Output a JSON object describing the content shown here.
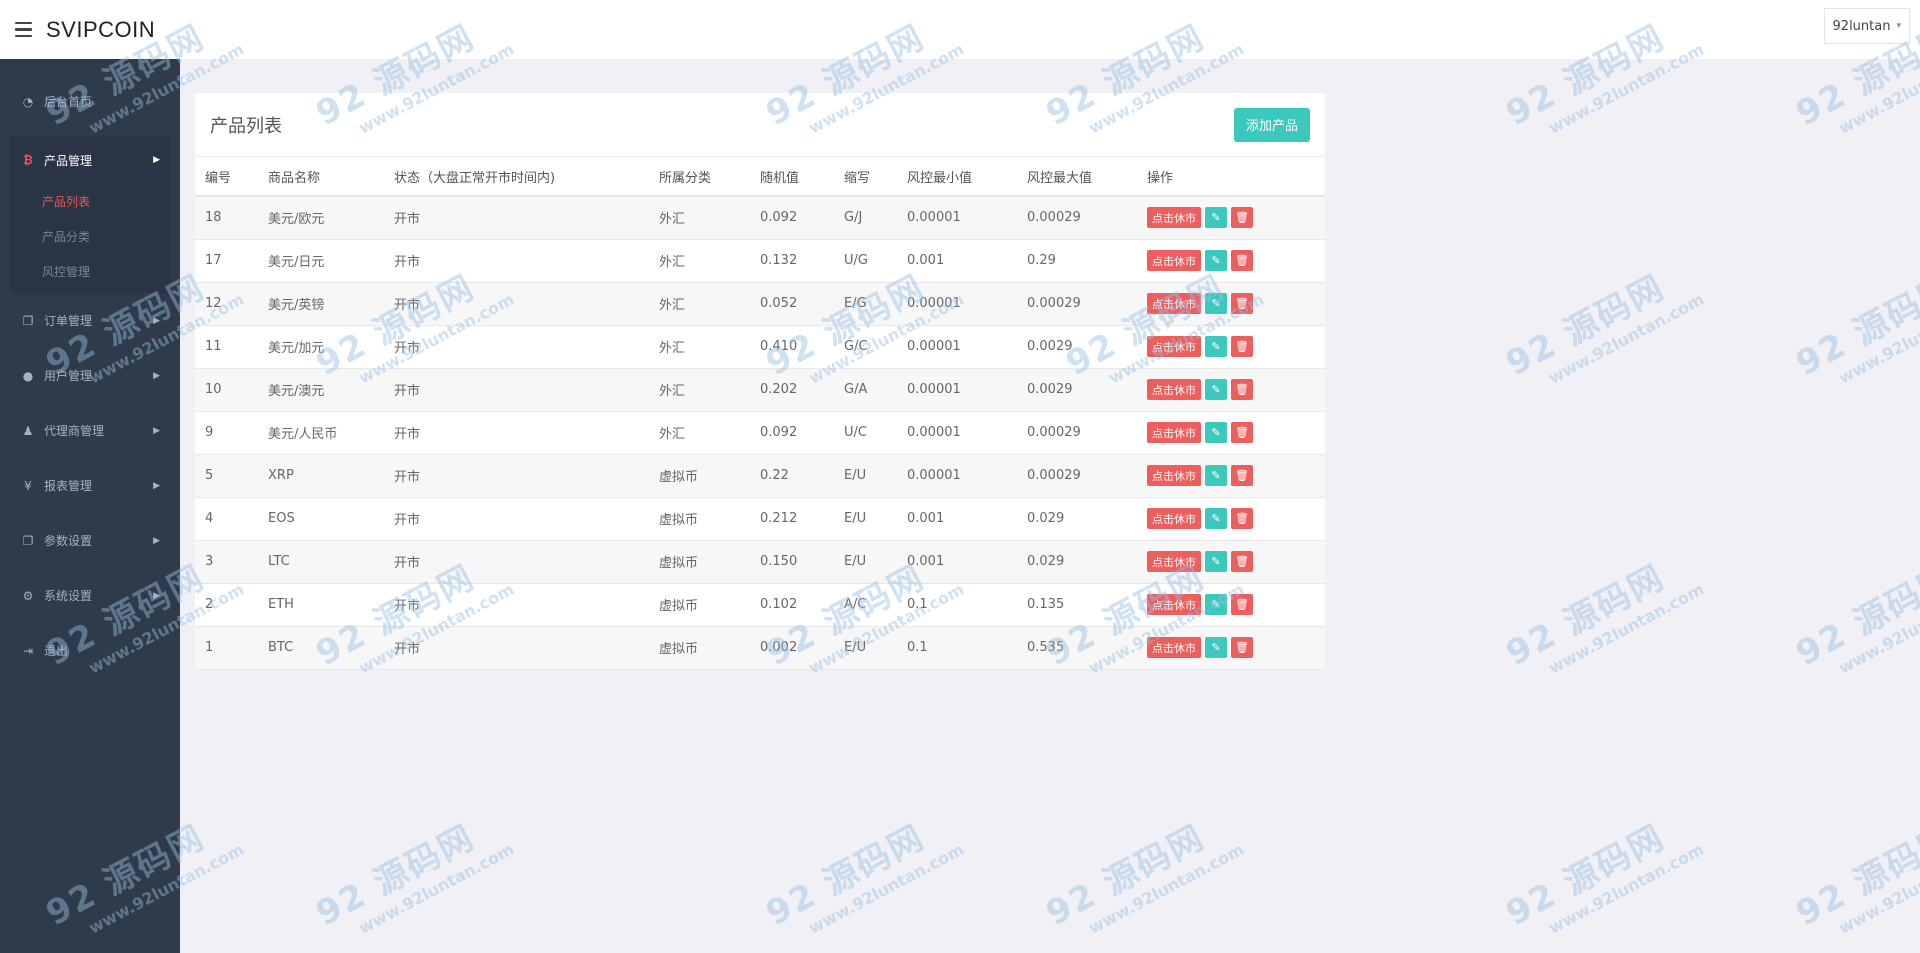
{
  "header": {
    "brand": "SVIPCOIN",
    "user": "92luntan"
  },
  "sidebar": {
    "items": [
      {
        "label": "后台首页",
        "icon": "dashboard-icon"
      },
      {
        "label": "产品管理",
        "icon": "bitcoin-icon"
      },
      {
        "label": "订单管理",
        "icon": "copy-icon"
      },
      {
        "label": "用户管理",
        "icon": "user-icon"
      },
      {
        "label": "代理商管理",
        "icon": "users-icon"
      },
      {
        "label": "报表管理",
        "icon": "yen-icon"
      },
      {
        "label": "参数设置",
        "icon": "copy-icon"
      },
      {
        "label": "系统设置",
        "icon": "gears-icon"
      },
      {
        "label": "退出",
        "icon": "sign-out-icon"
      }
    ],
    "sub_items": [
      {
        "label": "产品列表",
        "active": true
      },
      {
        "label": "产品分类",
        "active": false
      },
      {
        "label": "风控管理",
        "active": false
      }
    ]
  },
  "panel": {
    "title": "产品列表",
    "add_button": "添加产品"
  },
  "table": {
    "columns": [
      "编号",
      "商品名称",
      "状态（大盘正常开市时间内)",
      "所属分类",
      "随机值",
      "缩写",
      "风控最小值",
      "风控最大值",
      "操作"
    ],
    "action_label": "点击休市",
    "rows": [
      {
        "id": "18",
        "name": "美元/欧元",
        "status": "开市",
        "category": "外汇",
        "random": "0.092",
        "abbr": "G/J",
        "min": "0.00001",
        "max": "0.00029"
      },
      {
        "id": "17",
        "name": "美元/日元",
        "status": "开市",
        "category": "外汇",
        "random": "0.132",
        "abbr": "U/G",
        "min": "0.001",
        "max": "0.29"
      },
      {
        "id": "12",
        "name": "美元/英镑",
        "status": "开市",
        "category": "外汇",
        "random": "0.052",
        "abbr": "E/G",
        "min": "0.00001",
        "max": "0.00029"
      },
      {
        "id": "11",
        "name": "美元/加元",
        "status": "开市",
        "category": "外汇",
        "random": "0.410",
        "abbr": "G/C",
        "min": "0.00001",
        "max": "0.0029"
      },
      {
        "id": "10",
        "name": "美元/澳元",
        "status": "开市",
        "category": "外汇",
        "random": "0.202",
        "abbr": "G/A",
        "min": "0.00001",
        "max": "0.0029"
      },
      {
        "id": "9",
        "name": "美元/人民币",
        "status": "开市",
        "category": "外汇",
        "random": "0.092",
        "abbr": "U/C",
        "min": "0.00001",
        "max": "0.00029"
      },
      {
        "id": "5",
        "name": "XRP",
        "status": "开市",
        "category": "虚拟币",
        "random": "0.22",
        "abbr": "E/U",
        "min": "0.00001",
        "max": "0.00029"
      },
      {
        "id": "4",
        "name": "EOS",
        "status": "开市",
        "category": "虚拟币",
        "random": "0.212",
        "abbr": "E/U",
        "min": "0.001",
        "max": "0.029"
      },
      {
        "id": "3",
        "name": "LTC",
        "status": "开市",
        "category": "虚拟币",
        "random": "0.150",
        "abbr": "E/U",
        "min": "0.001",
        "max": "0.029"
      },
      {
        "id": "2",
        "name": "ETH",
        "status": "开市",
        "category": "虚拟币",
        "random": "0.102",
        "abbr": "A/C",
        "min": "0.1",
        "max": "0.135"
      },
      {
        "id": "1",
        "name": "BTC",
        "status": "开市",
        "category": "虚拟币",
        "random": "0.002",
        "abbr": "E/U",
        "min": "0.1",
        "max": "0.535"
      }
    ]
  },
  "watermark": {
    "main": "92 源码网",
    "url": "www.92luntan.com"
  }
}
